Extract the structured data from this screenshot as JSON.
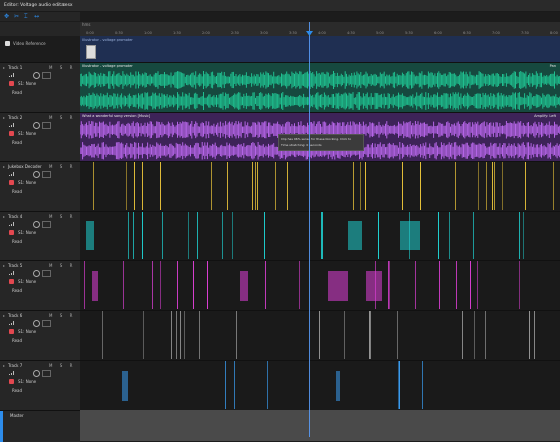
{
  "window": {
    "title": "Editor: Voltage audio edit.sesx",
    "menu_icon": "≡"
  },
  "toolbar": {
    "icons": [
      "move-tool-icon",
      "razor-tool-icon",
      "time-select-tool-icon",
      "slip-tool-icon"
    ]
  },
  "ruler": {
    "unit": "hms",
    "ticks": [
      "0:00",
      "0:30",
      "1:00",
      "1:30",
      "2:00",
      "2:30",
      "3:00",
      "3:30",
      "4:00",
      "4:30",
      "5:00",
      "5:30",
      "6:00",
      "6:30",
      "7:00",
      "7:30",
      "8:00"
    ]
  },
  "video": {
    "checkbox_label": "Video Reference",
    "clip_name": "Illustrator - voltage promoter"
  },
  "tracks": [
    {
      "name": "Track 1",
      "input": "S1: None",
      "mode": "Read",
      "clip": "Illustrator - voltage promoter",
      "clip_right": "Pan",
      "color": "#1fbf8f"
    },
    {
      "name": "Track 2",
      "input": "S1: None",
      "mode": "Read",
      "clip": "What a wonderful song version [Music]",
      "clip_right": "Amplify: Left",
      "color": "#b464e6"
    },
    {
      "name": "Jukebox Decoder",
      "input": "S1: None",
      "mode": "Read",
      "clip": "",
      "clip_right": "",
      "color": "#e8c23a"
    },
    {
      "name": "Track 4",
      "input": "S1: None",
      "mode": "Read",
      "clip": "",
      "clip_right": "",
      "color": "#1fcfcf"
    },
    {
      "name": "Track 5",
      "input": "S1: None",
      "mode": "Read",
      "clip": "",
      "clip_right": "",
      "color": "#e040d8"
    },
    {
      "name": "Track 6",
      "input": "S1: None",
      "mode": "Read",
      "clip": "",
      "clip_right": "",
      "color": "#9a9a9a"
    },
    {
      "name": "Track 7",
      "input": "S1: None",
      "mode": "Read",
      "clip": "",
      "clip_right": "",
      "color": "#3a9cf0"
    }
  ],
  "tooltip": {
    "line1": "Clip has 96% sense for these blocking. Click to",
    "line2": "Time stretching: 0 seconds"
  },
  "mix": {
    "name": "Master",
    "mode": "Read"
  },
  "labels": {
    "m": "M",
    "s": "S",
    "r": "R"
  }
}
